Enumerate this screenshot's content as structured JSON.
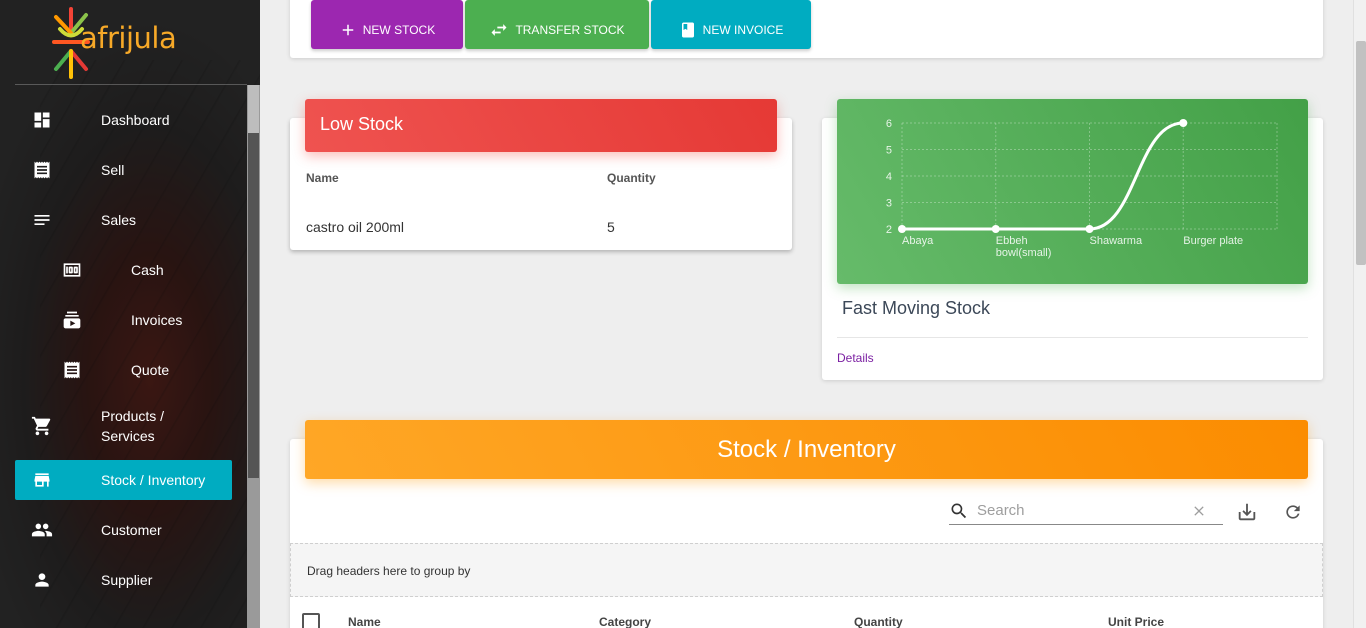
{
  "brand": {
    "name": "afrijula"
  },
  "sidebar": {
    "items": [
      {
        "label": "Dashboard",
        "icon": "dashboard-icon"
      },
      {
        "label": "Sell",
        "icon": "receipt-icon"
      },
      {
        "label": "Sales",
        "icon": "list-icon"
      },
      {
        "label": "Cash",
        "icon": "money-icon"
      },
      {
        "label": "Invoices",
        "icon": "subscriptions-icon"
      },
      {
        "label": "Quote",
        "icon": "receipt-icon"
      },
      {
        "label": "Products /\nServices",
        "icon": "cart-icon"
      },
      {
        "label": "Stock / Inventory",
        "icon": "store-icon",
        "active": true
      },
      {
        "label": "Customer",
        "icon": "people-icon"
      },
      {
        "label": "Supplier",
        "icon": "person-icon"
      }
    ]
  },
  "actions": {
    "new_stock": "NEW STOCK",
    "transfer_stock": "TRANSFER STOCK",
    "new_invoice": "NEW INVOICE"
  },
  "low_stock": {
    "title": "Low Stock",
    "columns": [
      "Name",
      "Quantity"
    ],
    "rows": [
      {
        "name": "castro oil 200ml",
        "quantity": "5"
      }
    ]
  },
  "fast_moving": {
    "title": "Fast Moving Stock",
    "details_link": "Details"
  },
  "chart_data": {
    "type": "line",
    "categories": [
      "Abaya",
      "Ebbeh bowl(small)",
      "Shawarma",
      "Burger plate"
    ],
    "series": [
      {
        "values": [
          2,
          2,
          2,
          6
        ]
      }
    ],
    "yticks": [
      "2",
      "3",
      "4",
      "5",
      "6"
    ],
    "ylim": [
      2,
      6
    ],
    "grid": true,
    "colors": {
      "line": "#ffffff",
      "background": "#4caf50"
    }
  },
  "inventory": {
    "title": "Stock / Inventory",
    "search_placeholder": "Search",
    "group_hint": "Drag headers here to group by",
    "columns": [
      "Name",
      "Category",
      "Quantity",
      "Unit Price"
    ]
  },
  "colors": {
    "purple": "#9c27b0",
    "green": "#4caf50",
    "cyan": "#00acc1",
    "red": "#e53935",
    "orange": "#fb8c00"
  }
}
